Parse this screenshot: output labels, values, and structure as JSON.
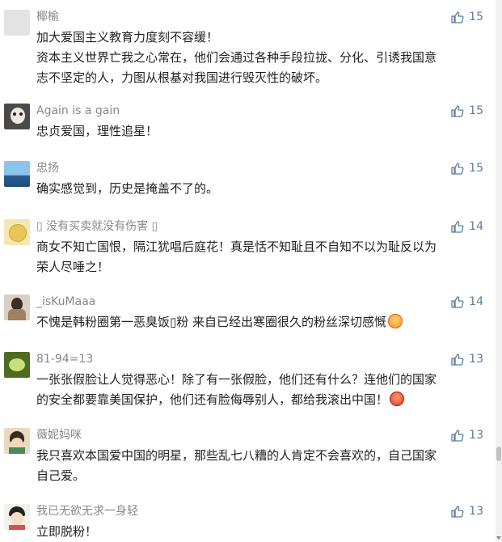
{
  "comments": [
    {
      "name": "椰榆",
      "text_lines": [
        "加大爱国主义教育力度刻不容缓！",
        "资本主义世界亡我之心常在，他们会通过各种手段拉拢、分化、引诱我国意",
        "志不坚定的人，力图从根基对我国进行毁灭性的破坏。"
      ],
      "likes": "15",
      "avatar_color": "#e3e3e3"
    },
    {
      "name": "Again is a gain",
      "text_lines": [
        "忠贞爱国，理性追星！"
      ],
      "likes": "15",
      "avatar_color": "#4a4a4a"
    },
    {
      "name": "忠扬",
      "text_lines": [
        "确实感觉到，历史是掩盖不了的。"
      ],
      "likes": "15",
      "avatar_color": "#3c78b5"
    },
    {
      "name": "▯ 没有买卖就没有伤害 ▯",
      "text_lines": [
        "商女不知亡国恨，隔江犹唱后庭花！真是恬不知耻且不自知不以为耻反以为",
        "荣人尽唾之！"
      ],
      "likes": "14",
      "avatar_color": "#e8c65a"
    },
    {
      "name": "_isKuMaaa",
      "text_lines": [
        "不愧是韩粉圈第一恶臭饭▯粉 来自已经出寒圈很久的粉丝深切感慨"
      ],
      "likes": "14",
      "avatar_color": "#a08060"
    },
    {
      "name": "81-94=13",
      "text_lines": [
        "一张张假脸让人觉得恶心！除了有一张假脸，他们还有什么？连他们的国家",
        "的安全都要靠美国保护，他们还有脸侮辱别人，都给我滚出中国！"
      ],
      "likes": "13",
      "avatar_color": "#7fa03a"
    },
    {
      "name": "薇妮妈咪",
      "text_lines": [
        "我只喜欢本国爱中国的明星，那些乱七八糟的人肯定不会喜欢的，自己国家",
        "自己爱。"
      ],
      "likes": "13",
      "avatar_color": "#c7a27a"
    },
    {
      "name": "我已无欲无求一身轻",
      "text_lines": [
        "立即脱粉！"
      ],
      "likes": "13",
      "avatar_color": "#d94f4f"
    }
  ],
  "colors": {
    "name": "#888888",
    "text": "#222222",
    "like": "#5e7b9a"
  },
  "icons": {
    "like": "thumbs-up-icon",
    "emoji_shock": "shocked-face-emoji",
    "emoji_angry": "angry-face-emoji"
  }
}
